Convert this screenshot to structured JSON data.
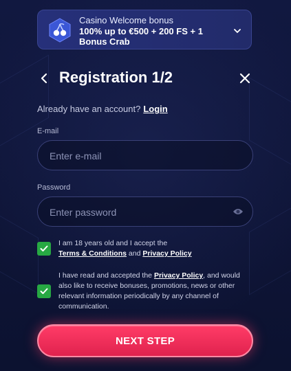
{
  "banner": {
    "title": "Casino Welcome bonus",
    "offer": "100% up to €500 + 200 FS + 1 Bonus Crab",
    "icon": "cherry-icon"
  },
  "header": {
    "title": "Registration 1/2"
  },
  "account": {
    "prompt": "Already have an account?",
    "login_label": "Login"
  },
  "email": {
    "label": "E-mail",
    "placeholder": "Enter e-mail",
    "value": ""
  },
  "password": {
    "label": "Password",
    "placeholder": "Enter password",
    "value": ""
  },
  "consent_age": {
    "checked": true,
    "text_a": "I am 18 years old and I accept the",
    "terms_link": "Terms & Conditions",
    "and": "and",
    "privacy_link": "Privacy Policy"
  },
  "consent_marketing": {
    "checked": true,
    "text_a": "I have read and accepted the",
    "privacy_link": "Privacy Policy",
    "text_b": ", and would also like to receive bonuses, promotions, news or other relevant information periodically by any channel of communication."
  },
  "next_button": {
    "label": "NEXT STEP"
  },
  "colors": {
    "background": "#0d1330",
    "accent": "#ff3c67",
    "checkbox": "#27a843"
  }
}
